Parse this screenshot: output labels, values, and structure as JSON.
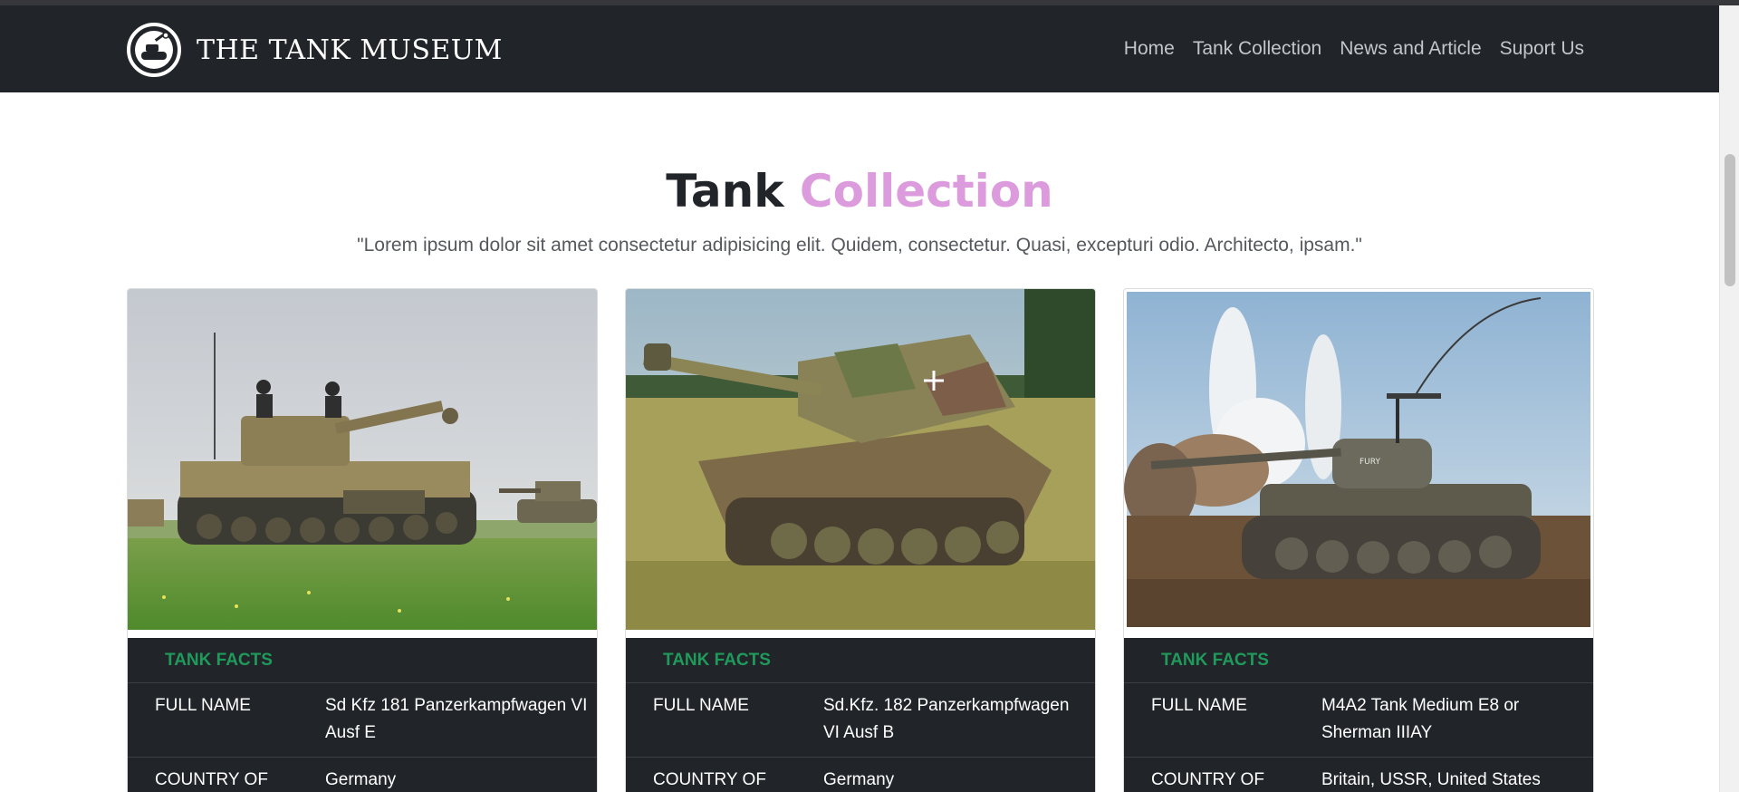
{
  "navbar": {
    "brand_text": "THE TANK MUSEUM",
    "brand_icon": "tank-emblem-icon",
    "links": [
      {
        "label": "Home"
      },
      {
        "label": "Tank Collection"
      },
      {
        "label": "News and Article"
      },
      {
        "label": "Suport Us"
      }
    ]
  },
  "section": {
    "title_main": "Tank",
    "title_accent": "Collection",
    "subtitle": "\"Lorem ipsum dolor sit amet consectetur adipisicing elit. Quidem, consectetur. Quasi, excepturi odio. Architecto, ipsam.\""
  },
  "cards": [
    {
      "facts_heading": "TANK FACTS",
      "full_name_label": "FULL NAME",
      "full_name": "Sd Kfz 181 Panzerkampfwagen VI Ausf E",
      "country_label": "COUNTRY OF",
      "country": "Germany"
    },
    {
      "facts_heading": "TANK FACTS",
      "full_name_label": "FULL NAME",
      "full_name": "Sd.Kfz. 182 Panzerkampfwagen VI Ausf B",
      "country_label": "COUNTRY OF",
      "country": "Germany"
    },
    {
      "facts_heading": "TANK FACTS",
      "full_name_label": "FULL NAME",
      "full_name": "M4A2 Tank Medium E8 or Sherman IIIAY",
      "country_label": "COUNTRY OF",
      "country": "Britain, USSR, United States"
    }
  ],
  "colors": {
    "navbar_bg": "#212529",
    "title_accent": "#dc9bdc",
    "facts_heading": "#1f9a5b"
  }
}
